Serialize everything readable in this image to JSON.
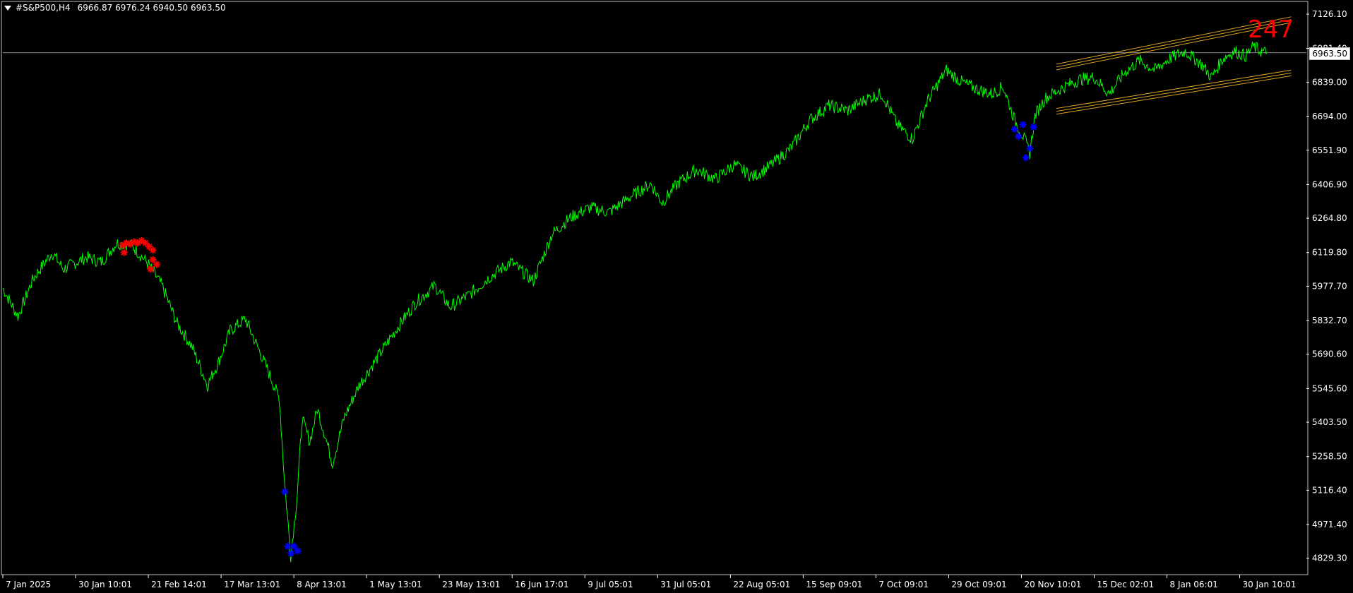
{
  "header": {
    "symbol": "#S&P500,H4",
    "ohlc": "6966.87 6976.24 6940.50 6963.50"
  },
  "counter_label": "247",
  "current_price_label": "6963.50",
  "colors": {
    "background": "#000000",
    "price_line": "#00ff00",
    "axis": "#ffffff",
    "sell_marker": "#ff0000",
    "buy_marker": "#0000ff",
    "channel": "#daa520",
    "counter": "#ff0000"
  },
  "chart_data": {
    "type": "line",
    "title": "",
    "xlabel": "",
    "ylabel": "",
    "ylim": [
      4760,
      7180
    ],
    "y_ticks": [
      "7126.10",
      "6981.40",
      "6839.00",
      "6694.00",
      "6551.90",
      "6406.90",
      "6264.80",
      "6119.80",
      "5977.70",
      "5832.70",
      "5690.60",
      "5545.60",
      "5403.50",
      "5258.50",
      "5116.40",
      "4971.40",
      "4829.30"
    ],
    "x_ticks": [
      "7 Jan 2025",
      "30 Jan 10:01",
      "21 Feb 14:01",
      "17 Mar 13:01",
      "8 Apr 13:01",
      "1 May 13:01",
      "23 May 13:01",
      "16 Jun 17:01",
      "9 Jul 05:01",
      "31 Jul 05:01",
      "22 Aug 05:01",
      "15 Sep 09:01",
      "7 Oct 09:01",
      "29 Oct 09:01",
      "20 Nov 10:01",
      "15 Dec 02:01",
      "8 Jan 06:01",
      "30 Jan 10:01"
    ],
    "x_range_bars": [
      0,
      1720
    ],
    "x_tick_positions": [
      0,
      96,
      192,
      288,
      384,
      480,
      576,
      672,
      768,
      864,
      960,
      1056,
      1152,
      1248,
      1344,
      1440,
      1536,
      1632
    ],
    "series": [
      {
        "points": [
          [
            0,
            5970
          ],
          [
            20,
            5850
          ],
          [
            40,
            6010
          ],
          [
            65,
            6120
          ],
          [
            80,
            6050
          ],
          [
            110,
            6100
          ],
          [
            130,
            6080
          ],
          [
            150,
            6160
          ],
          [
            170,
            6150
          ],
          [
            190,
            6080
          ],
          [
            210,
            5980
          ],
          [
            230,
            5820
          ],
          [
            250,
            5720
          ],
          [
            270,
            5560
          ],
          [
            285,
            5660
          ],
          [
            300,
            5790
          ],
          [
            320,
            5840
          ],
          [
            335,
            5730
          ],
          [
            350,
            5620
          ],
          [
            365,
            5500
          ],
          [
            372,
            5140
          ],
          [
            380,
            4840
          ],
          [
            388,
            5080
          ],
          [
            395,
            5420
          ],
          [
            405,
            5320
          ],
          [
            415,
            5460
          ],
          [
            425,
            5350
          ],
          [
            435,
            5230
          ],
          [
            450,
            5420
          ],
          [
            470,
            5560
          ],
          [
            495,
            5680
          ],
          [
            520,
            5800
          ],
          [
            545,
            5910
          ],
          [
            570,
            5980
          ],
          [
            590,
            5890
          ],
          [
            615,
            5940
          ],
          [
            640,
            6010
          ],
          [
            670,
            6080
          ],
          [
            700,
            6000
          ],
          [
            725,
            6200
          ],
          [
            750,
            6270
          ],
          [
            775,
            6310
          ],
          [
            800,
            6290
          ],
          [
            830,
            6360
          ],
          [
            855,
            6410
          ],
          [
            870,
            6330
          ],
          [
            890,
            6410
          ],
          [
            915,
            6470
          ],
          [
            940,
            6430
          ],
          [
            965,
            6490
          ],
          [
            990,
            6440
          ],
          [
            1010,
            6480
          ],
          [
            1040,
            6560
          ],
          [
            1065,
            6680
          ],
          [
            1090,
            6740
          ],
          [
            1115,
            6720
          ],
          [
            1140,
            6770
          ],
          [
            1160,
            6790
          ],
          [
            1180,
            6660
          ],
          [
            1200,
            6600
          ],
          [
            1220,
            6760
          ],
          [
            1245,
            6890
          ],
          [
            1265,
            6840
          ],
          [
            1285,
            6810
          ],
          [
            1305,
            6790
          ],
          [
            1320,
            6820
          ],
          [
            1335,
            6680
          ],
          [
            1345,
            6620
          ],
          [
            1355,
            6540
          ],
          [
            1362,
            6700
          ],
          [
            1375,
            6770
          ],
          [
            1395,
            6810
          ],
          [
            1420,
            6850
          ],
          [
            1440,
            6860
          ],
          [
            1460,
            6790
          ],
          [
            1480,
            6880
          ],
          [
            1500,
            6930
          ],
          [
            1520,
            6890
          ],
          [
            1540,
            6940
          ],
          [
            1560,
            6970
          ],
          [
            1580,
            6920
          ],
          [
            1595,
            6860
          ],
          [
            1610,
            6940
          ],
          [
            1625,
            6970
          ],
          [
            1640,
            6950
          ],
          [
            1650,
            6990
          ],
          [
            1660,
            6970
          ],
          [
            1668,
            6963.5
          ]
        ]
      }
    ],
    "sell_markers": [
      [
        158,
        6150
      ],
      [
        163,
        6160
      ],
      [
        168,
        6155
      ],
      [
        173,
        6165
      ],
      [
        178,
        6160
      ],
      [
        183,
        6170
      ],
      [
        188,
        6160
      ],
      [
        193,
        6145
      ],
      [
        198,
        6130
      ],
      [
        160,
        6120
      ],
      [
        198,
        6090
      ],
      [
        203,
        6070
      ],
      [
        195,
        6050
      ]
    ],
    "buy_markers": [
      [
        372,
        5110
      ],
      [
        376,
        4880
      ],
      [
        380,
        4850
      ],
      [
        384,
        4880
      ],
      [
        389,
        4860
      ],
      [
        1335,
        6640
      ],
      [
        1340,
        6610
      ],
      [
        1346,
        6660
      ],
      [
        1350,
        6520
      ],
      [
        1355,
        6560
      ],
      [
        1360,
        6650
      ]
    ],
    "channel_lines": [
      [
        [
          1390,
          6915
        ],
        [
          1700,
          7115
        ]
      ],
      [
        [
          1390,
          6903
        ],
        [
          1700,
          7103
        ]
      ],
      [
        [
          1390,
          6891
        ],
        [
          1700,
          7091
        ]
      ],
      [
        [
          1390,
          6728
        ],
        [
          1700,
          6890
        ]
      ],
      [
        [
          1390,
          6716
        ],
        [
          1700,
          6878
        ]
      ],
      [
        [
          1390,
          6704
        ],
        [
          1700,
          6866
        ]
      ]
    ],
    "current_price": 6963.5,
    "grid": false,
    "legend": "none"
  }
}
